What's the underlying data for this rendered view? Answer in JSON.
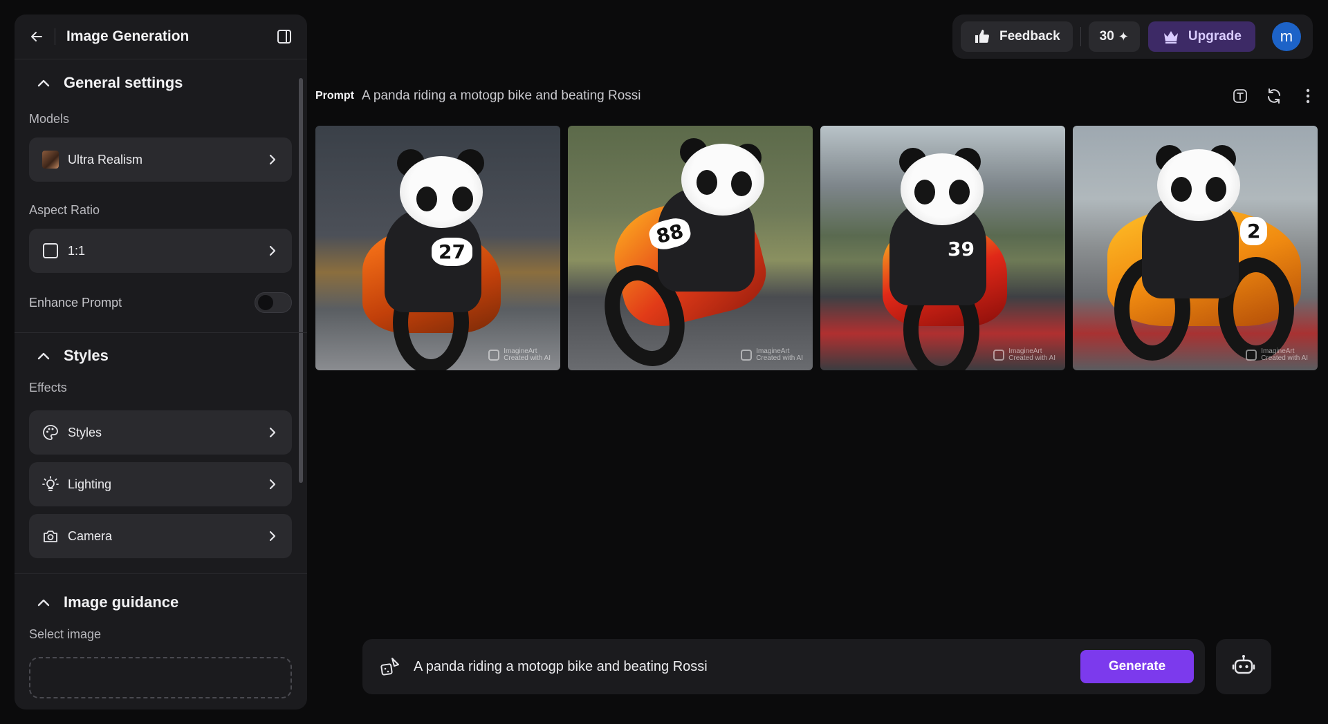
{
  "sidebar": {
    "title": "Image Generation",
    "general": {
      "heading": "General settings",
      "models_label": "Models",
      "model_value": "Ultra Realism",
      "aspect_label": "Aspect Ratio",
      "aspect_value": "1:1",
      "enhance_label": "Enhance Prompt",
      "enhance_on": false
    },
    "styles": {
      "heading": "Styles",
      "effects_label": "Effects",
      "items": [
        {
          "label": "Styles",
          "icon": "palette-icon"
        },
        {
          "label": "Lighting",
          "icon": "bulb-icon"
        },
        {
          "label": "Camera",
          "icon": "camera-icon"
        }
      ]
    },
    "guidance": {
      "heading": "Image guidance",
      "select_label": "Select image"
    }
  },
  "topbar": {
    "feedback_label": "Feedback",
    "credits": "30",
    "upgrade_label": "Upgrade",
    "user_initial": "m"
  },
  "prompt": {
    "label": "Prompt",
    "text": "A panda riding a motogp bike and beating Rossi"
  },
  "images": [
    {
      "number": "27",
      "watermark": "ImagineArt",
      "caption": "Created with AI"
    },
    {
      "number": "88",
      "watermark": "ImagineArt",
      "caption": "Created with AI"
    },
    {
      "number": "39",
      "watermark": "ImagineArt",
      "caption": "Created with AI"
    },
    {
      "number": "2",
      "watermark": "ImagineArt",
      "caption": "Created with AI"
    }
  ],
  "composer": {
    "value": "A panda riding a motogp bike and beating Rossi",
    "generate_label": "Generate"
  },
  "colors": {
    "accent": "#7c3aed",
    "upgrade_bg": "#3d2a66",
    "avatar": "#1d63c8"
  }
}
